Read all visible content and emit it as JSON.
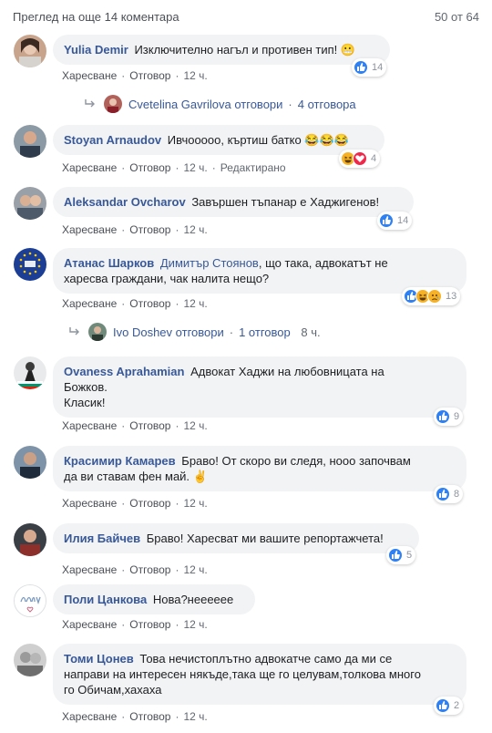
{
  "header": {
    "more_comments": "Преглед на още 14 коментара",
    "counter": "50 от 64"
  },
  "labels": {
    "like": "Харесване",
    "reply": "Отговор",
    "edited": "Редактирано",
    "dot": "·"
  },
  "comments": [
    {
      "author": "Yulia Demir",
      "text": "Изключително нагъл и противен тип! 😬",
      "time": "12 ч.",
      "reactions": {
        "icons": [
          "like-icon"
        ],
        "count": "14"
      },
      "replies": {
        "name": "Cvetelina Gavrilova",
        "verb": "отговори",
        "count_label": "4 отговора"
      }
    },
    {
      "author": "Stoyan Arnaudov",
      "text": "Ивчооооо, къртиш батко 😂😂😂",
      "time": "12 ч.",
      "edited": true,
      "reactions": {
        "icons": [
          "haha-icon",
          "love-icon"
        ],
        "count": "4"
      }
    },
    {
      "author": "Aleksandar Ovcharov",
      "text": "Завършен тъпанар е Хаджигенов!",
      "time": "12 ч.",
      "reactions": {
        "icons": [
          "like-icon"
        ],
        "count": "14"
      }
    },
    {
      "author": "Атанас Шарков",
      "mention": "Димитър Стоянов",
      "text_line1": ", що така, адвокатът не",
      "text_line2": "харесва граждани, чак налита нещо?",
      "time": "12 ч.",
      "reactions": {
        "icons": [
          "like-icon",
          "haha-icon",
          "sad-icon"
        ],
        "count": "13"
      },
      "replies": {
        "name": "Ivo Doshev",
        "verb": "отговори",
        "count_label": "1 отговор",
        "time": "8 ч."
      }
    },
    {
      "author": "Ovaness Aprahamian",
      "text_line1": "Адвокат Хаджи на любовницата на",
      "text_line2": "Божков.",
      "text_line3": "Класик!",
      "time": "12 ч.",
      "reactions": {
        "icons": [
          "like-icon"
        ],
        "count": "9"
      }
    },
    {
      "author": "Красимир Камарев",
      "text_line1": "Браво! От скоро ви следя, нооо започвам",
      "text_line2": "да ви ставам фен май. ✌️",
      "time": "12 ч.",
      "reactions": {
        "icons": [
          "like-icon"
        ],
        "count": "8"
      }
    },
    {
      "author": "Илия Байчев",
      "text": "Браво! Харесват ми вашите репортажчета!",
      "time": "12 ч.",
      "reactions": {
        "icons": [
          "like-icon"
        ],
        "count": "5"
      }
    },
    {
      "author": "Поли Цанкова",
      "text": "Нова?нееееее",
      "time": "12 ч."
    },
    {
      "author": "Томи Цонев",
      "text_line1": "Това нечистоплътно адвокатче само да ми се",
      "text_line2": "направи на интересен някъде,така ще го целувам,толкова много",
      "text_line3": "го Обичам,хахаха",
      "time": "12 ч.",
      "reactions": {
        "icons": [
          "like-icon"
        ],
        "count": "2"
      }
    }
  ]
}
